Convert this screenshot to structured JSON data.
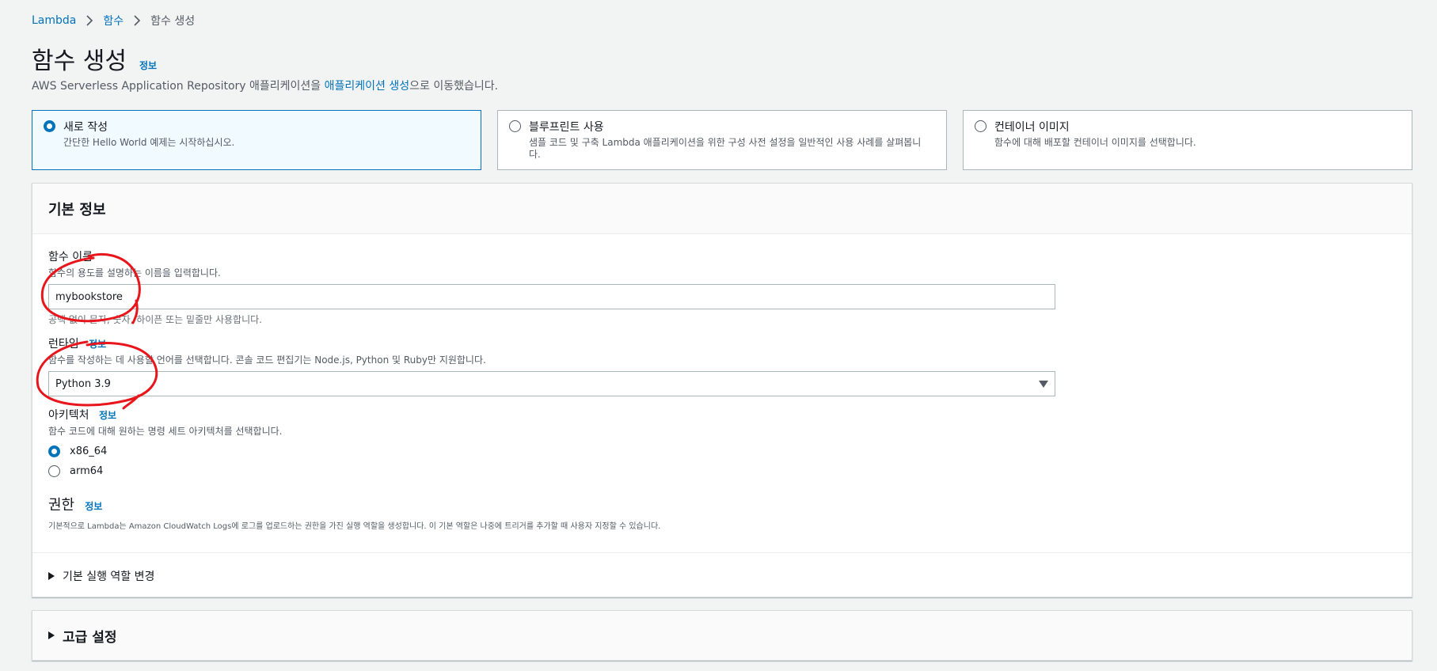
{
  "breadcrumb": {
    "items": [
      "Lambda",
      "함수",
      "함수 생성"
    ]
  },
  "header": {
    "title": "함수 생성",
    "info": "정보",
    "subtitle_prefix": "AWS Serverless Application Repository 애플리케이션을 ",
    "subtitle_link": "애플리케이션 생성",
    "subtitle_suffix": "으로 이동했습니다."
  },
  "options": [
    {
      "title": "새로 작성",
      "desc": "간단한 Hello World 예제는 시작하십시오.",
      "selected": true
    },
    {
      "title": "블루프린트 사용",
      "desc": "샘플 코드 및 구축 Lambda 애플리케이션을 위한 구성 사전 설정을 일반적인 사용 사례를 살펴봅니다.",
      "selected": false
    },
    {
      "title": "컨테이너 이미지",
      "desc": "함수에 대해 배포할 컨테이너 이미지를 선택합니다.",
      "selected": false
    }
  ],
  "basic": {
    "title": "기본 정보",
    "function_name": {
      "label": "함수 이름",
      "desc": "함수의 용도를 설명하는 이름을 입력합니다.",
      "value": "mybookstore",
      "constraint": "공백 없이 문자, 숫자, 하이픈 또는 밑줄만 사용합니다."
    },
    "runtime": {
      "label": "런타임",
      "info": "정보",
      "desc": "함수를 작성하는 데 사용할 언어를 선택합니다. 콘솔 코드 편집기는 Node.js, Python 및 Ruby만 지원합니다.",
      "value": "Python 3.9"
    },
    "architecture": {
      "label": "아키텍처",
      "info": "정보",
      "desc": "함수 코드에 대해 원하는 명령 세트 아키텍처를 선택합니다.",
      "options": [
        "x86_64",
        "arm64"
      ],
      "selected": "x86_64"
    },
    "permissions": {
      "title": "권한",
      "info": "정보",
      "desc": "기본적으로 Lambda는 Amazon CloudWatch Logs에 로그를 업로드하는 권한을 가진 실행 역할을 생성합니다. 이 기본 역할은 나중에 트리거를 추가할 때 사용자 지정할 수 있습니다."
    },
    "change_role": "기본 실행 역할 변경"
  },
  "advanced": {
    "title": "고급 설정"
  },
  "colors": {
    "accent": "#0073bb",
    "annotation": "#e8161c"
  }
}
